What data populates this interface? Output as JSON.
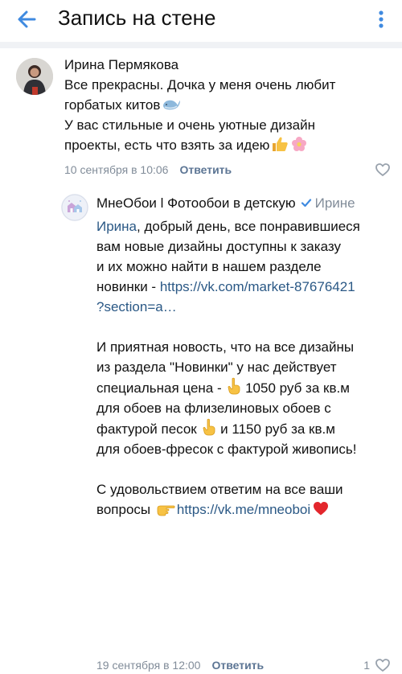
{
  "header": {
    "title": "Запись на стене",
    "back_icon": "arrow-left-icon",
    "menu_icon": "more-vertical-icon",
    "accent": "#3f8ae0"
  },
  "comments": [
    {
      "author": "Ирина Пермякова",
      "lines": [
        "Все прекрасны. Дочка у меня очень любит",
        "горбатых китов",
        "У вас стильные и очень уютные дизайн",
        "проекты, есть что взять за идею"
      ],
      "date": "10 сентября в 10:06",
      "reply_label": "Ответить",
      "like_count": ""
    },
    {
      "author": "МнеОбои l Фотообои в детскую",
      "reply_to": "Ирине",
      "mention": "Ирина",
      "lines": [
        ", добрый день, все понравившиеся",
        "вам новые дизайны доступны к заказу",
        "и их можно найти в нашем разделе",
        "новинки - ",
        "?section=a…",
        "И приятная новость, что на все дизайны",
        "из раздела \"Новинки\" у нас действует",
        "специальная цена - ",
        " 1050 руб за кв.м",
        "для обоев на флизелиновых обоев с",
        "фактурой песок ",
        " и 1150 руб за кв.м",
        "для обоев-фресок с фактурой живопись!",
        "С удовольствием ответим на все ваши",
        "вопросы "
      ],
      "link_market": "https://vk.com/market-87676421",
      "link_message": "https://vk.me/mneoboi",
      "date": "19 сентября в 12:00",
      "reply_label": "Ответить",
      "like_count": "1"
    }
  ],
  "colors": {
    "link": "#2a5885",
    "meta": "#818c99",
    "reply": "#5c7594",
    "verified": "#3f8ae0"
  }
}
